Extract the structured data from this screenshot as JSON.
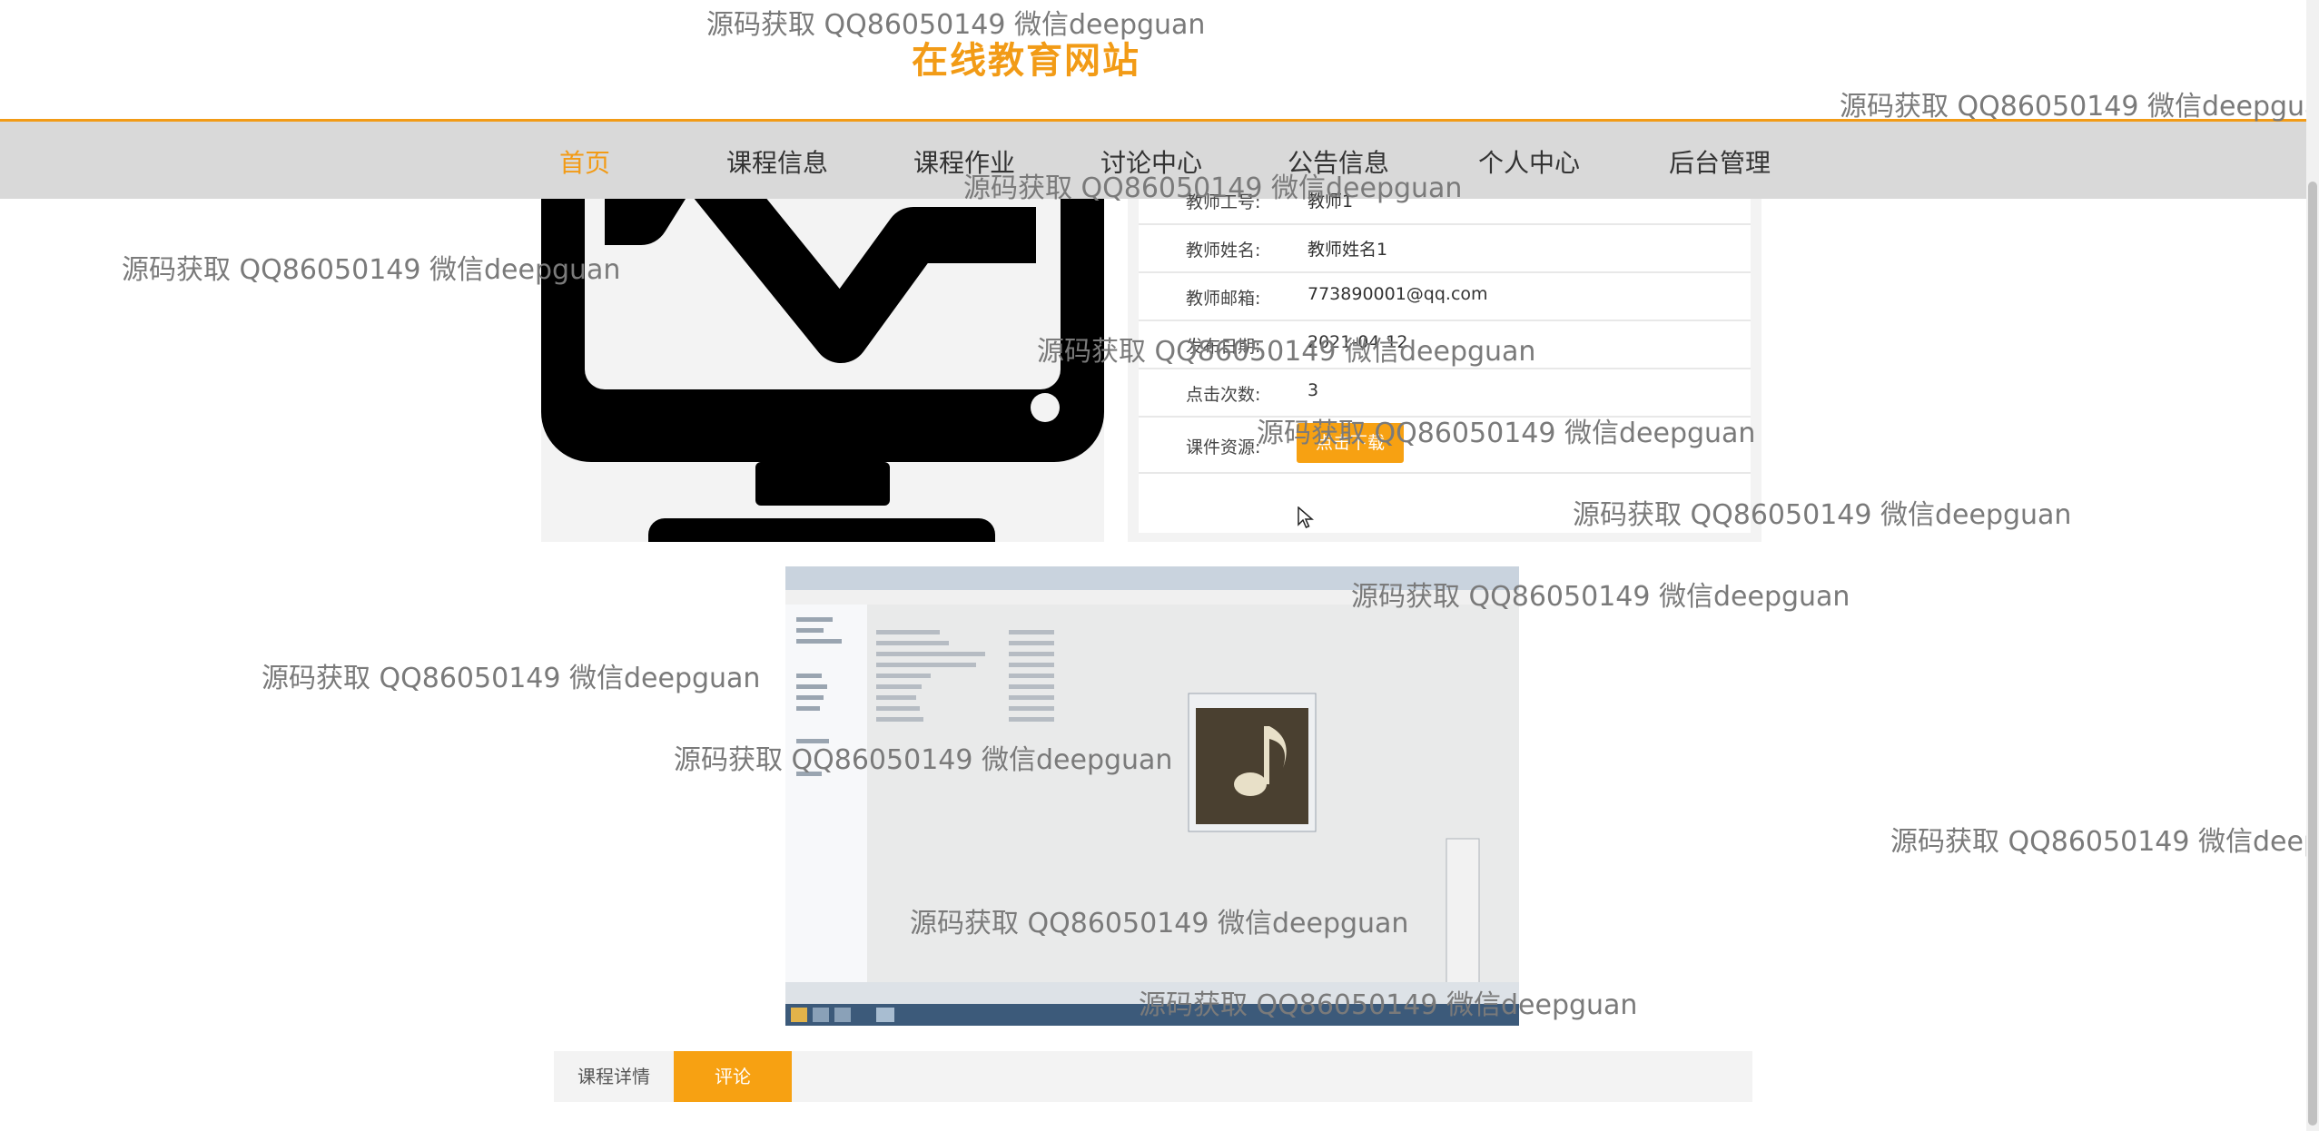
{
  "site": {
    "title": "在线教育网站"
  },
  "nav": {
    "items": [
      "首页",
      "课程信息",
      "课程作业",
      "讨论中心",
      "公告信息",
      "个人中心",
      "后台管理"
    ],
    "active_index": 0
  },
  "info": {
    "rows": [
      {
        "label": "教师工号:",
        "value": "教师1"
      },
      {
        "label": "教师姓名:",
        "value": "教师姓名1"
      },
      {
        "label": "教师邮箱:",
        "value": "773890001@qq.com"
      },
      {
        "label": "发布日期:",
        "value": "2021-04-12"
      },
      {
        "label": "点击次数:",
        "value": "3"
      }
    ],
    "resource_label": "课件资源:",
    "download_button": "点击下载"
  },
  "tabs": {
    "details": "课程详情",
    "comments": "评论",
    "active": "comments"
  },
  "watermark": "源码获取 QQ86050149 微信deepguan",
  "colors": {
    "accent": "#f29b16",
    "button": "#f7a112",
    "nav_bg": "#d9d9d9"
  }
}
